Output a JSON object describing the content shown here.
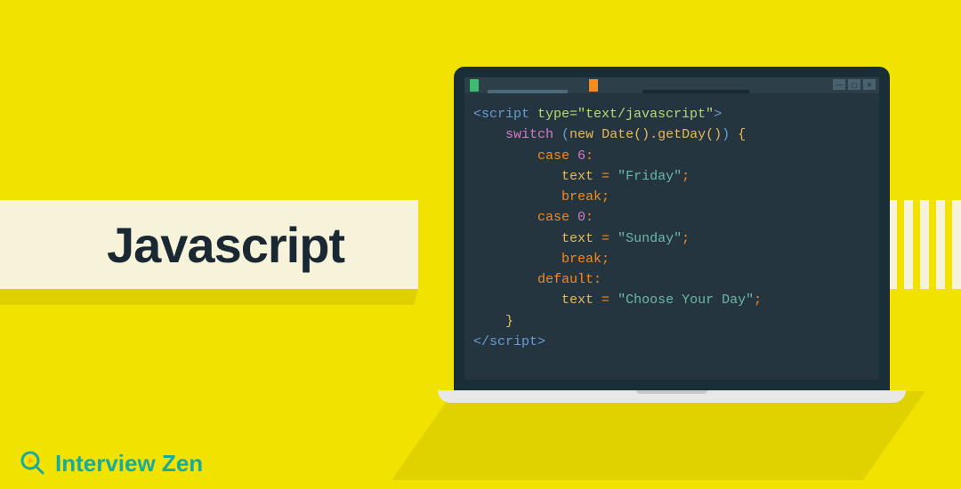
{
  "title": "Javascript",
  "brand": {
    "name": "Interview Zen"
  },
  "code": {
    "open_tag_before": "<script ",
    "open_tag_attr": "type=\"text/javascript\"",
    "open_tag_after": ">",
    "switch_kw": "switch",
    "switch_expr_open": " (",
    "new_kw": "new ",
    "date_call": "Date()",
    "getday_call": ".getDay()",
    "switch_expr_close": ") ",
    "brace_open": "{",
    "case_kw": "case ",
    "case6_val": "6",
    "colon": ":",
    "text_var": "text ",
    "equals": "= ",
    "friday_str": "\"Friday\"",
    "semicolon": ";",
    "break_kw": "break",
    "case0_val": "0",
    "sunday_str": "\"Sunday\"",
    "default_kw": "default",
    "choose_str": "\"Choose Your Day\"",
    "brace_close": "}",
    "close_tag": "</script>"
  },
  "window_controls": {
    "minimize": "—",
    "maximize": "◻",
    "close": "✕"
  }
}
